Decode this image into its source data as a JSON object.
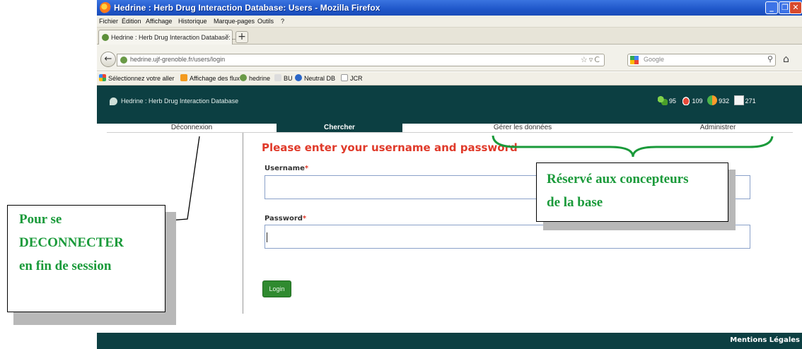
{
  "window": {
    "title": "Hedrine : Herb Drug Interaction Database: Users - Mozilla Firefox",
    "minimize": "_",
    "maximize": "❐",
    "close": "✕"
  },
  "menu": [
    "Fichier",
    "Édition",
    "Affichage",
    "Historique",
    "Marque-pages",
    "Outils",
    "?"
  ],
  "tab": {
    "label": "Hedrine : Herb Drug Interaction Database: ...",
    "new_tab": "+"
  },
  "nav": {
    "url": "hedrine.ujf-grenoble.fr/users/login",
    "search_placeholder": "Google"
  },
  "bookmarks": [
    "Sélectionnez votre aller",
    "Affichage des flux",
    "hedrine",
    "BU",
    "Neutral DB",
    "JCR"
  ],
  "site": {
    "title": "Hedrine : Herb Drug Interaction Database",
    "stats": [
      {
        "icon": "herb-icon",
        "value": "95"
      },
      {
        "icon": "drug-icon",
        "value": "109"
      },
      {
        "icon": "interaction-icon",
        "value": "932"
      },
      {
        "icon": "document-icon",
        "value": "271"
      }
    ],
    "nav": [
      {
        "label": "Déconnexion",
        "active": false
      },
      {
        "label": "Chercher",
        "active": true
      },
      {
        "label": "Gérer les données",
        "active": false
      },
      {
        "label": "Administrer",
        "active": false
      }
    ]
  },
  "login": {
    "heading": "Please enter your username and password",
    "username_label": "Username",
    "password_label": "Password",
    "required_mark": "*",
    "username_value": "",
    "password_value": "",
    "button": "Login"
  },
  "footer": {
    "legal": "Mentions Légales"
  },
  "annotations": {
    "left": [
      "Pour se",
      "DECONNECTER",
      "en fin de session"
    ],
    "right": [
      "Réservé aux concepteurs",
      "de la base"
    ],
    "text_color": "#1a9a3a"
  },
  "colors": {
    "header": "#0c3f42",
    "heading": "#e03a2a",
    "login_button": "#2f8a2f"
  }
}
